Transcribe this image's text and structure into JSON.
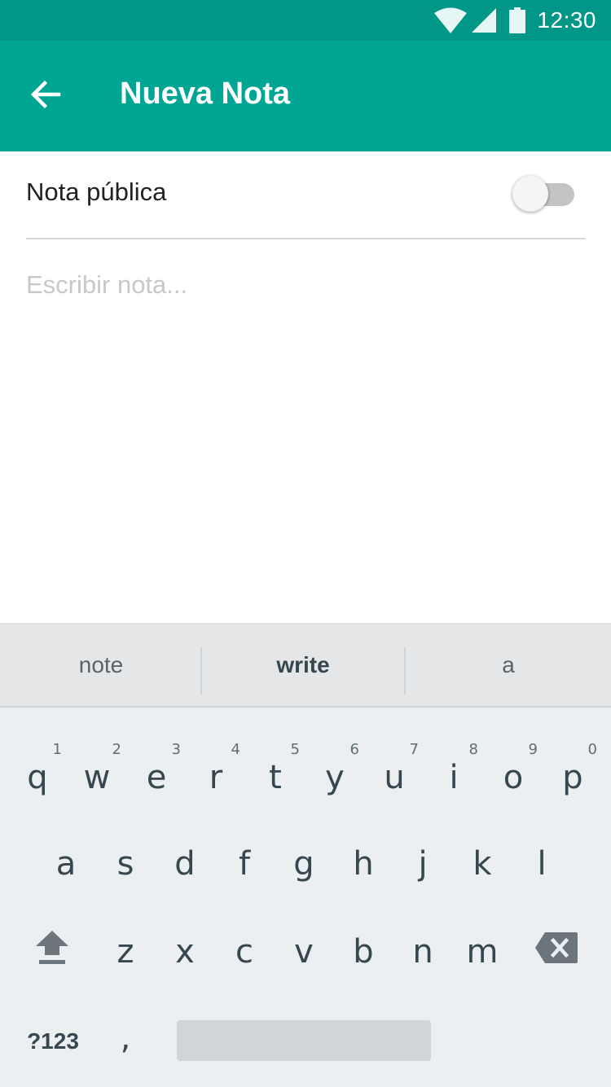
{
  "status_bar": {
    "time": "12:30",
    "icons": [
      "wifi-icon",
      "signal-icon",
      "battery-icon"
    ]
  },
  "app_bar": {
    "back_icon": "arrow-left-icon",
    "title": "Nueva Nota"
  },
  "public_toggle": {
    "label": "Nota pública",
    "enabled": false
  },
  "note": {
    "value": "",
    "placeholder": "Escribir nota..."
  },
  "keyboard": {
    "suggestions": [
      "note",
      "write",
      "a"
    ],
    "row1": [
      {
        "key": "q",
        "hint": "1"
      },
      {
        "key": "w",
        "hint": "2"
      },
      {
        "key": "e",
        "hint": "3"
      },
      {
        "key": "r",
        "hint": "4"
      },
      {
        "key": "t",
        "hint": "5"
      },
      {
        "key": "y",
        "hint": "6"
      },
      {
        "key": "u",
        "hint": "7"
      },
      {
        "key": "i",
        "hint": "8"
      },
      {
        "key": "o",
        "hint": "9"
      },
      {
        "key": "p",
        "hint": "0"
      }
    ],
    "row2": [
      "a",
      "s",
      "d",
      "f",
      "g",
      "h",
      "j",
      "k",
      "l"
    ],
    "row3": [
      "z",
      "x",
      "c",
      "v",
      "b",
      "n",
      "m"
    ],
    "symbols_label": "?123",
    "comma_label": ",",
    "shift_icon": "shift-icon",
    "backspace_icon": "backspace-icon"
  },
  "colors": {
    "status_bar": "#009688",
    "app_bar": "#00A693",
    "keyboard_bg": "#ECEFF1",
    "key_text": "#37474F"
  }
}
